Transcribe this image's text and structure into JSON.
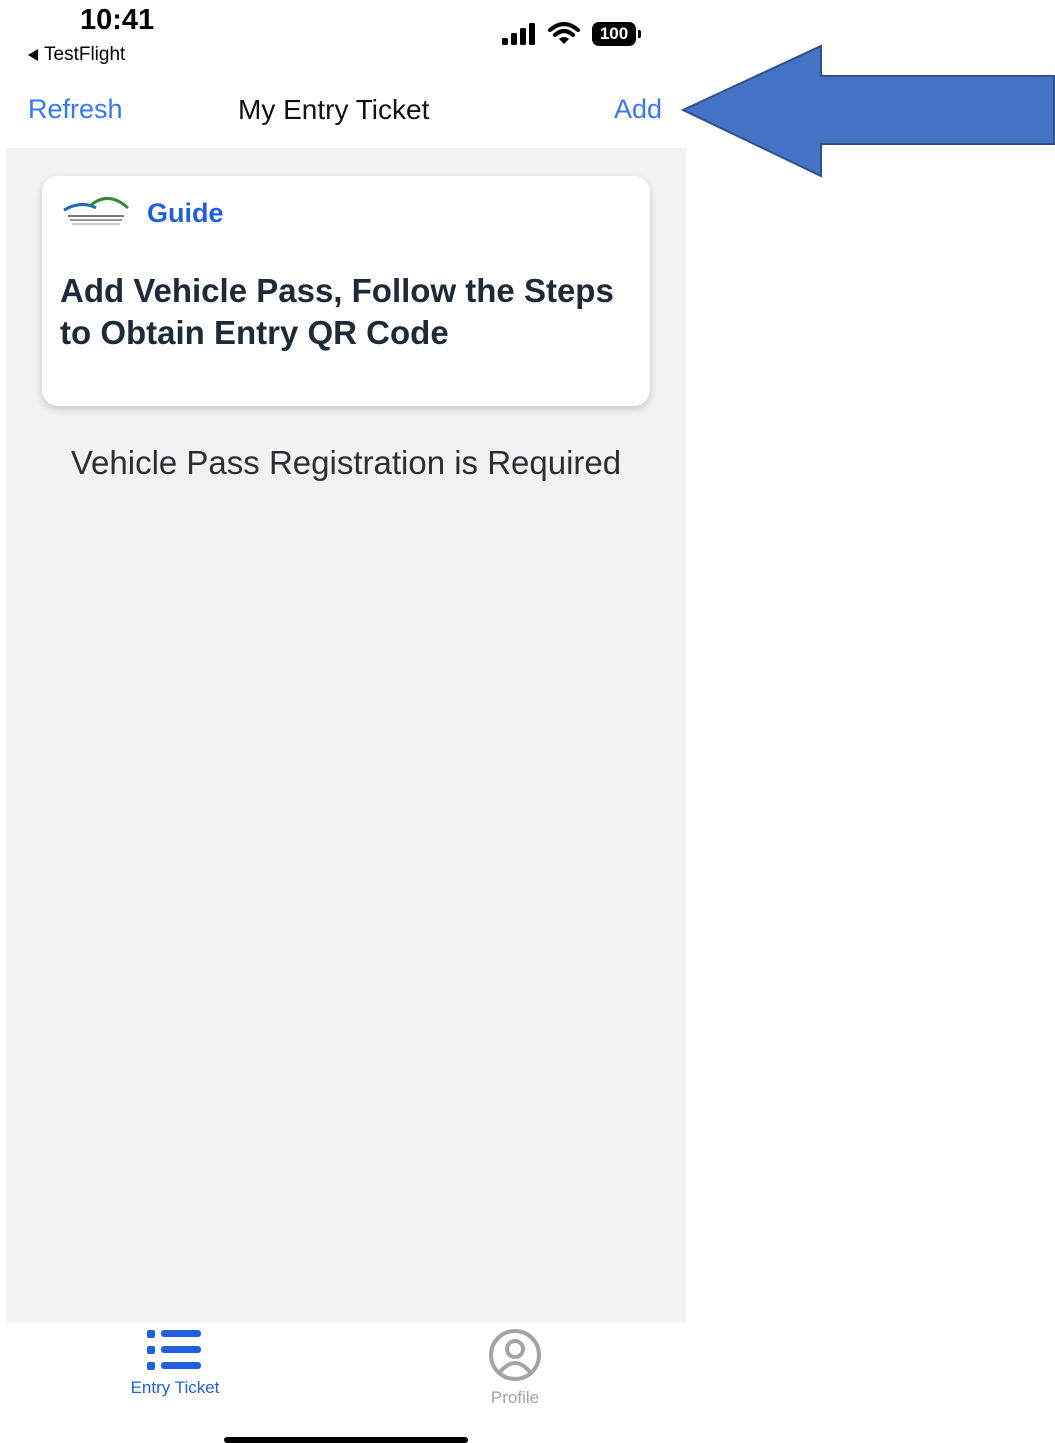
{
  "status_bar": {
    "time": "10:41",
    "back_app": "TestFlight",
    "battery": "100"
  },
  "nav": {
    "refresh_label": "Refresh",
    "title": "My Entry Ticket",
    "add_label": "Add"
  },
  "guide_card": {
    "label": "Guide",
    "text": "Add Vehicle Pass, Follow the Steps to Obtain Entry QR Code"
  },
  "notice": "Vehicle Pass Registration is Required",
  "tabs": [
    {
      "label": "Entry Ticket",
      "icon": "list-icon",
      "active": true
    },
    {
      "label": "Profile",
      "icon": "person-circle-icon",
      "active": false
    }
  ],
  "colors": {
    "accent": "#3478f6",
    "active_tab": "#1f5fe0",
    "inactive_tab": "#a0a4a8",
    "content_bg": "#f2f2f2",
    "annotation_arrow": "#4472c4"
  }
}
